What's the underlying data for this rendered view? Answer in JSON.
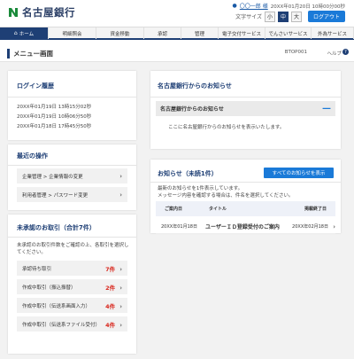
{
  "header": {
    "logo_text": "名古屋銀行",
    "user_name": "〇〇一郎 様",
    "last_login": "20XX年01月20日 10時00分00秒",
    "font_size_label": "文字サイズ",
    "font_sizes": [
      "小",
      "中",
      "大"
    ],
    "font_size_selected": "中",
    "logout_label": "ログアウト",
    "brand_color": "#1e3f75",
    "accent_color": "#1a7ad8"
  },
  "nav": {
    "items": [
      {
        "label": "ホーム",
        "active": true
      },
      {
        "label": "明細照会"
      },
      {
        "label": "資金移動"
      },
      {
        "label": "承認"
      },
      {
        "label": "管理"
      },
      {
        "label": "電子交付サービス"
      },
      {
        "label": "でんさいサービス"
      },
      {
        "label": "外為サービス"
      }
    ]
  },
  "page": {
    "title": "メニュー画面",
    "code": "BTOP001",
    "help_label": "ヘルプ",
    "help_icon": "?"
  },
  "login_history": {
    "title": "ログイン履歴",
    "entries": [
      "20XX年01月19日 13時15分02秒",
      "20XX年01月19日 10時06分50秒",
      "20XX年01月18日 17時45分50秒"
    ]
  },
  "recent_ops": {
    "title": "最近の操作",
    "items": [
      "企業管理 > 企業情報の変更",
      "利用者管理 > パスワード変更"
    ]
  },
  "pending": {
    "title": "未承認のお取引（合計7件）",
    "description": "未承認のお取引件数をご確認の上、各取引を選択してください。",
    "items": [
      {
        "label": "承認待ち取引",
        "count": "7件"
      },
      {
        "label": "作成中取引（振込振替）",
        "count": "2件"
      },
      {
        "label": "作成中取引（伝送系画面入力）",
        "count": "4件"
      },
      {
        "label": "作成中取引（伝送系ファイル受付）",
        "count": "4件"
      }
    ]
  },
  "bank_notice": {
    "title": "名古屋銀行からのお知らせ",
    "section_label": "名古屋銀行からのお知らせ",
    "body": "ここに名古屋銀行からのお知らせを表示いたします。",
    "collapse_icon": "minus-icon"
  },
  "notices": {
    "title": "お知らせ（未読1件）",
    "all_button": "すべてのお知らせを表示",
    "message_line1": "最新のお知らせを1件表示しています。",
    "message_line2": "メッセージ内容を確認する場合は、件名を選択してください。",
    "columns": [
      "ご案内日",
      "タイトル",
      "掲載終了日"
    ],
    "rows": [
      {
        "date": "20XX年01月18日",
        "title": "ユーザーＩＤ登録受付のご案内",
        "end_date": "20XX年02月18日"
      }
    ]
  }
}
